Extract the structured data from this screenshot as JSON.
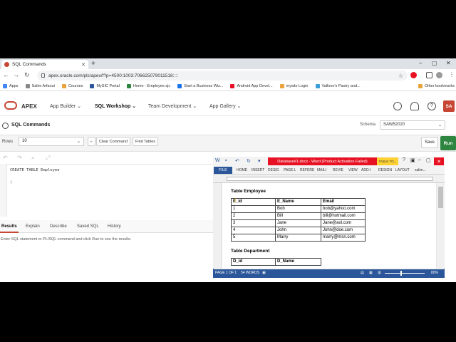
{
  "browser": {
    "tab_title": "SQL Commands",
    "url": "apex.oracle.com/pls/apex/f?p=4500:1003:706625079011518::::",
    "bookmarks": [
      {
        "label": "Apps",
        "color": "#4285f4"
      },
      {
        "label": "Salim Arfaoui",
        "color": "#888888"
      },
      {
        "label": "Courses",
        "color": "#e8a33c"
      },
      {
        "label": "MySIC Portal",
        "color": "#2b579a"
      },
      {
        "label": "Home - Employee.sjc",
        "color": "#2e8540"
      },
      {
        "label": "Start a Business Wiz...",
        "color": "#1a73e8"
      },
      {
        "label": "Android App Devel...",
        "color": "#e81123"
      },
      {
        "label": "mysite Login",
        "color": "#e8a33c"
      },
      {
        "label": "Vallone's Pastry and...",
        "color": "#3a9fd9"
      },
      {
        "label": "Other bookmarks",
        "color": "#e8a33c"
      }
    ]
  },
  "apex": {
    "brand": "APEX",
    "nav": [
      "App Builder",
      "SQL Workshop",
      "Team Development",
      "App Gallery"
    ],
    "active_nav": "SQL Workshop",
    "avatar": "SA",
    "page_title": "SQL Commands",
    "schema_label": "Schema",
    "schema_value": "SAW52020",
    "rows_label": "Rows",
    "rows_value": "10",
    "clear_command": "Clear Command",
    "find_tables": "Find Tables",
    "save": "Save",
    "run": "Run",
    "code_line1": "CREATE TABLE Employee",
    "code_line2": ")",
    "result_tabs": [
      "Results",
      "Explain",
      "Describe",
      "Saved SQL",
      "History"
    ],
    "result_message": "Enter SQL statement or PL/SQL command and click Run to see the results."
  },
  "word": {
    "title": "Database#1.docx - Word (Product Activation Failed)",
    "tools_label": "TABLE TO...",
    "file_tab": "FILE",
    "ribbon_tabs": [
      "HOME",
      "INSERT",
      "DESIG",
      "PAGE L",
      "REFERE",
      "MAILI",
      "REVIE",
      "VIEW",
      "ADD-I",
      "DESIGN",
      "LAYOUT",
      "salim..."
    ],
    "heading_employee": "Table Employee",
    "employee_headers": [
      "E_id",
      "E_Name",
      "Email"
    ],
    "employee_rows": [
      [
        "1",
        "Bob",
        "bob@yahoo.com"
      ],
      [
        "2",
        "Bill",
        "bill@hotmail.com"
      ],
      [
        "3",
        "Jane",
        "Jane@aol.com"
      ],
      [
        "4",
        "John",
        "John@doe.com"
      ],
      [
        "5",
        "Marry",
        "marry@msn.com"
      ]
    ],
    "heading_department": "Table Department",
    "department_headers": [
      "D_id",
      "D_Name"
    ],
    "status_page": "PAGE 1 OF 1",
    "status_words": "54 WORDS",
    "zoom": "80%"
  }
}
